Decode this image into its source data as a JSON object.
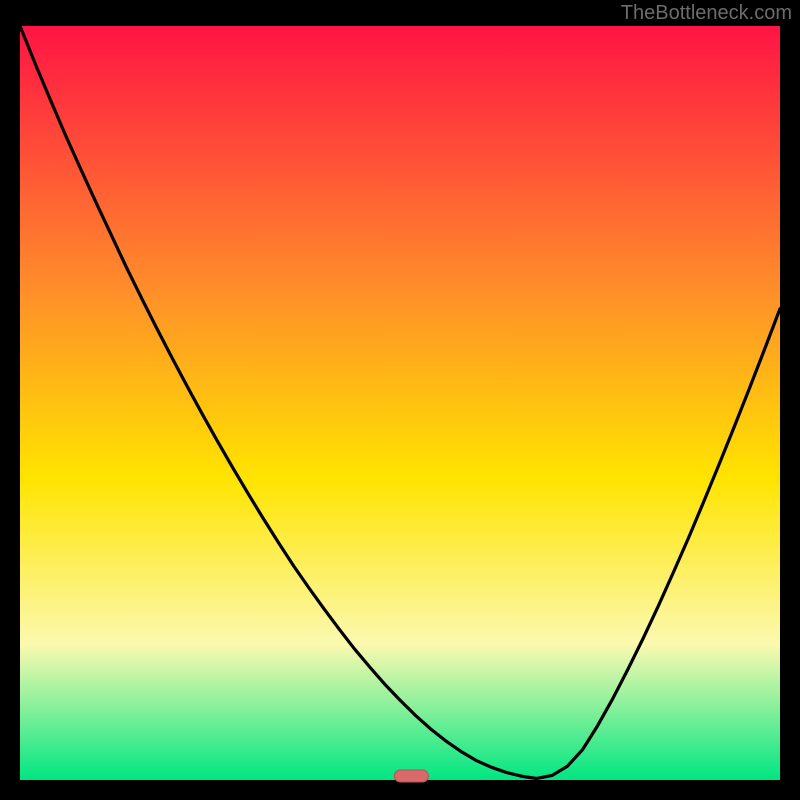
{
  "attribution": "TheBottleneck.com",
  "colors": {
    "grad_top": "#ff1444",
    "grad_mid_upper": "#ff8e2a",
    "grad_mid": "#ffe400",
    "grad_lower": "#fbf9b0",
    "grad_bottom": "#00e682",
    "background": "#000000",
    "curve": "#000000",
    "marker_fill": "#d86a6a",
    "marker_stroke": "#c05050"
  },
  "chart_data": {
    "type": "line",
    "title": "",
    "xlabel": "",
    "ylabel": "",
    "xlim": [
      0,
      100
    ],
    "ylim": [
      0,
      100
    ],
    "x": [
      0,
      2,
      4,
      6,
      8,
      10,
      12,
      14,
      16,
      18,
      20,
      22,
      24,
      26,
      28,
      30,
      32,
      34,
      36,
      38,
      40,
      42,
      44,
      46,
      48,
      50,
      52,
      54,
      56,
      58,
      60,
      62,
      64,
      66,
      68,
      70,
      72,
      74,
      76,
      78,
      80,
      82,
      84,
      86,
      88,
      90,
      92,
      94,
      96,
      98,
      100
    ],
    "values": [
      100,
      95,
      90.2,
      85.5,
      81,
      76.6,
      72.3,
      68,
      63.9,
      59.9,
      56,
      52.2,
      48.5,
      44.9,
      41.4,
      38,
      34.7,
      31.5,
      28.4,
      25.5,
      22.7,
      20,
      17.4,
      15,
      12.7,
      10.6,
      8.6,
      6.8,
      5.2,
      3.8,
      2.6,
      1.7,
      1.0,
      0.5,
      0.2,
      0.6,
      1.8,
      4.0,
      7.2,
      10.8,
      14.7,
      18.8,
      23.1,
      27.6,
      32.2,
      37.0,
      41.9,
      46.9,
      52.0,
      57.2,
      62.5
    ],
    "minimum_marker": {
      "x": 51.5,
      "y": 0
    },
    "legend": [],
    "annotations": []
  }
}
